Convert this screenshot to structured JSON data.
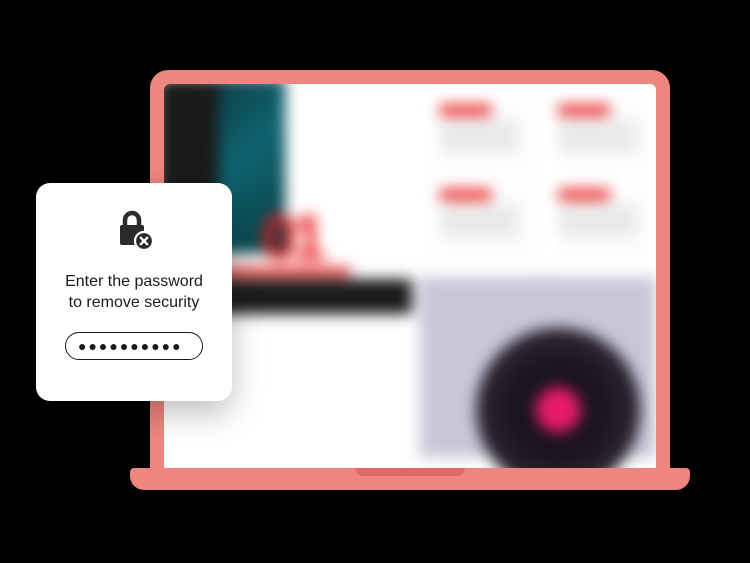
{
  "dialog": {
    "prompt_line1": "Enter the password",
    "prompt_line2": "to remove security",
    "password_mask": "●●●●●●●●●●"
  },
  "document": {
    "big_number": "01"
  }
}
